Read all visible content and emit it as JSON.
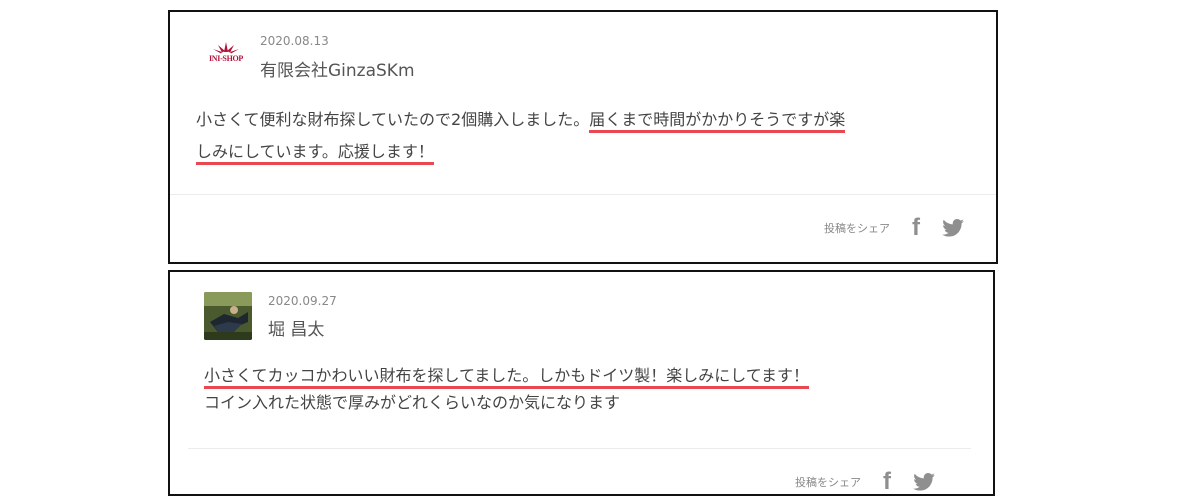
{
  "reviews": [
    {
      "date": "2020.08.13",
      "name": "有限会社GinzaSKm",
      "avatar_logo_text": "INI-SHOP",
      "comment_plain": "小さくて便利な財布探していたので2個購入しました。",
      "comment_highlight_1": "届くまで時間がかかりそうですが楽",
      "comment_highlight_2": "しみにしています。応援します！",
      "share_label": "投稿をシェア",
      "facebook_icon": "f"
    },
    {
      "date": "2020.09.27",
      "name": "堀 昌太",
      "comment_highlight": "小さくてカッコかわいい財布を探してました。しかもドイツ製！楽しみにしてます！",
      "comment_line2": "コイン入れた状態で厚みがどれくらいなのか気になります",
      "share_label": "投稿をシェア",
      "facebook_icon": "f"
    }
  ],
  "colors": {
    "highlight_underline": "#e8484f",
    "logo_red": "#b3123a",
    "icon_gray": "#8f8f8f"
  }
}
